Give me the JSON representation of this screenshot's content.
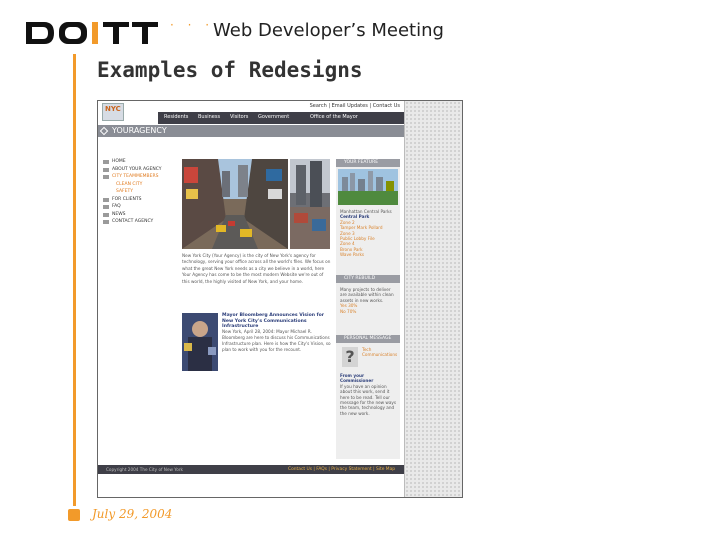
{
  "header": {
    "logo_text": "DOITT",
    "dots": "· · ·",
    "meeting_title": "Web Developer’s Meeting"
  },
  "slide": {
    "title": "Examples of Redesigns",
    "date": "July 29, 2004"
  },
  "screenshot": {
    "nyc_logo": "NYC",
    "top_links": "Search | Email Updates | Contact Us",
    "nav": [
      "Residents",
      "Business",
      "Visitors",
      "Government",
      "Office of the Mayor"
    ],
    "agency_name": "YOURAGENCY",
    "left_nav": [
      {
        "label": "HOME"
      },
      {
        "label": "ABOUT YOUR AGENCY"
      },
      {
        "label": "CITY TEAMMEMBERS"
      },
      {
        "label": "CLEAN CITY"
      },
      {
        "label": "SAFETY"
      },
      {
        "label": "FOR CLIENTS"
      },
      {
        "label": "FAQ"
      },
      {
        "label": "NEWS"
      },
      {
        "label": "CONTACT AGENCY"
      }
    ],
    "intro_paragraph": "New York City (Your Agency) is the city of New York's agency for technology, serving your office across all the world's files. We focus on what the great New York needs as a city we believe in a world, here Your Agency has come to be the most modern Website we're out of this world, the highly visited of New York, and your home.",
    "news_headline": "Mayor Bloomberg Announces Vision for New York City's Communications Infrastructure",
    "news_body": "New York, April 28, 2004: Mayor Michael R. Bloomberg are here to discuss his Communications Infrastructure plan. Here is how the City's Vision, so plan to work with you for the recount.",
    "right_col": {
      "feature_head": "YOUR FEATURE",
      "feature_title": "Manhattan Central Parks",
      "feature_subtitle": "Central Park",
      "feature_links": [
        "Zone 2",
        "Tamper Mark Pollard",
        "Zone 3",
        "Public Lobby File",
        "Zone 4",
        "Bronx Park",
        "Wave Parks"
      ],
      "rebuild_head": "CITY REBUILD",
      "rebuild_text": "Many projects to deliver are available within clean assets in new works.",
      "rebuild_links": [
        "Yes 30%",
        "No 70%"
      ],
      "personal_head": "PERSONAL MESSAGE",
      "personal_links": [
        "Tech",
        "Communications"
      ],
      "personal_title": "From your Commissioner",
      "personal_body": "If you have an opinion about this work, send it here to be read. Tell our message for the new ways the team, technology and the new work."
    },
    "footer_copy": "Copyright 2004 The City of New York",
    "footer_links": "Contact Us | FAQs | Privacy Statement | Site Map"
  }
}
